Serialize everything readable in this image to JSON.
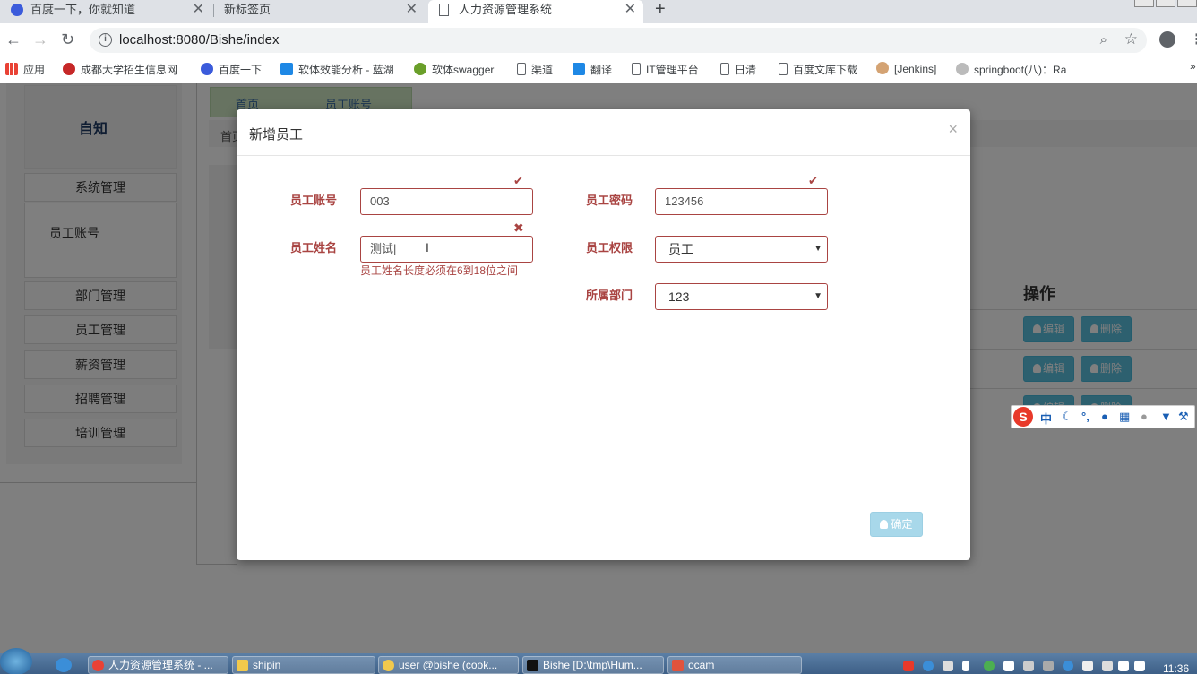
{
  "browser": {
    "tabs": [
      {
        "title": "百度一下，你就知道"
      },
      {
        "title": "新标签页"
      },
      {
        "title": "人力资源管理系统"
      }
    ],
    "url": "localhost:8080/Bishe/index",
    "bookmarks": [
      "应用",
      "成都大学招生信息网",
      "百度一下",
      "软体效能分析 - 蓝湖",
      "软体swagger",
      "渠道",
      "翻译",
      "IT管理平台",
      "日清",
      "百度文库下载",
      "[Jenkins]",
      "springboot(八)：Ra"
    ]
  },
  "sidebar": {
    "logo": "自知",
    "items": [
      {
        "label": "系统管理"
      },
      {
        "label": "部门管理"
      },
      {
        "label": "员工管理"
      },
      {
        "label": "薪资管理"
      },
      {
        "label": "招聘管理"
      },
      {
        "label": "培训管理"
      }
    ],
    "sub_item": "员工账号"
  },
  "page_tabs": [
    "首页",
    "员工账号"
  ],
  "breadcrumb": "首页",
  "table": {
    "action_header": "操作",
    "edit_label": "编辑",
    "delete_label": "删除"
  },
  "modal": {
    "title": "新增员工",
    "close": "×",
    "fields": {
      "account": {
        "label": "员工账号",
        "value": "003"
      },
      "password": {
        "label": "员工密码",
        "value": "123456"
      },
      "name": {
        "label": "员工姓名",
        "value": "测试|",
        "error": "员工姓名长度必须在6到18位之间"
      },
      "permission": {
        "label": "员工权限",
        "value": "员工"
      },
      "department": {
        "label": "所属部门",
        "value": "123"
      }
    },
    "confirm_label": "确定"
  },
  "ime": {
    "mode": "中",
    "logo": "S"
  },
  "taskbar": {
    "tasks": [
      "人力资源管理系统 - ...",
      "shipin",
      "user @bishe (cook...",
      "Bishe [D:\\tmp\\Hum...",
      "ocam"
    ],
    "clock": "11:36"
  },
  "colors": {
    "error": "#a94442",
    "info_button": "#5bc0de",
    "disabled_button": "#a8d8ea"
  }
}
